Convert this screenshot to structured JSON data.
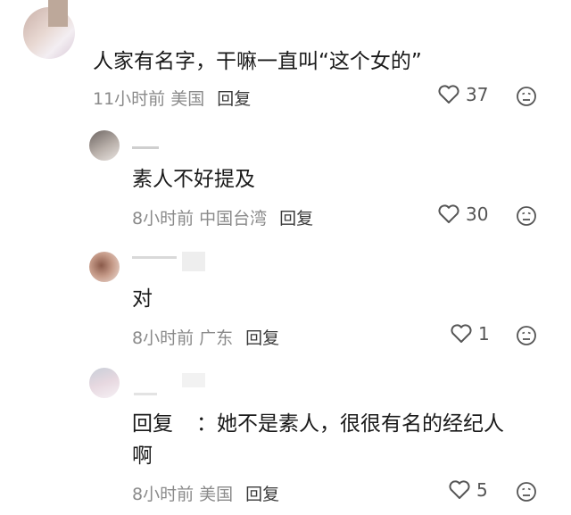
{
  "comments": [
    {
      "text": "人家有名字，干嘛一直叫“这个女的”",
      "time": "11小时前",
      "region": "美国",
      "reply_label": "回复",
      "likes": "37"
    },
    {
      "text": "素人不好提及",
      "time": "8小时前",
      "region": "中国台湾",
      "reply_label": "回复",
      "likes": "30"
    },
    {
      "text": "对",
      "time": "8小时前",
      "region": "广东",
      "reply_label": "回复",
      "likes": "1"
    },
    {
      "reply_prefix": "回复",
      "separator": "：",
      "text_line1": "她不是素人，很很有名的经纪人",
      "text_line2": "啊",
      "time": "8小时前",
      "region": "美国",
      "reply_label": "回复",
      "likes": "5"
    }
  ],
  "icons": {
    "like": "heart-outline-icon",
    "dislike": "dislike-face-icon"
  }
}
